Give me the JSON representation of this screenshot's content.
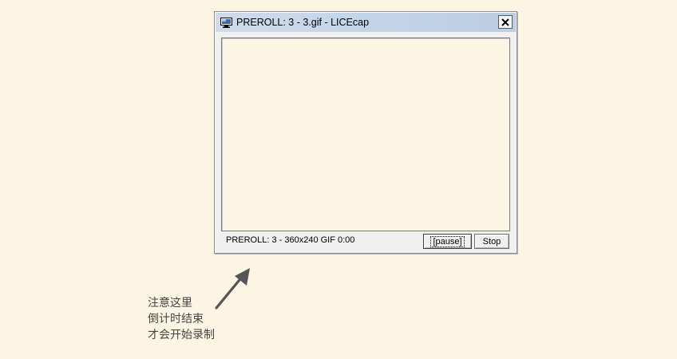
{
  "window": {
    "title": "PREROLL: 3 - 3.gif - LICEcap",
    "app_icon": "monitor-icon",
    "close_icon": "close-icon",
    "status_text": "PREROLL: 3 - 360x240 GIF 0:00",
    "pause_label": "[pause]",
    "stop_label": "Stop"
  },
  "annotation": {
    "lines": [
      "注意这里",
      "倒计时结束",
      "才会开始录制"
    ],
    "arrow_icon": "arrow-up-right-icon"
  },
  "colors": {
    "background": "#fcf5e3",
    "titlebar": "#c2d3e8"
  }
}
